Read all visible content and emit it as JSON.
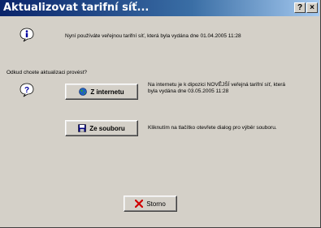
{
  "window": {
    "title": "Aktualizovat tarifní síť...",
    "help_button": "?",
    "close_button": "×"
  },
  "info": {
    "text": "Nyní používáte veřejnou tarifní síť, která byla vydána dne 01.04.2005 11:28"
  },
  "question": {
    "prompt": "Odkud chcete aktualizaci provést?"
  },
  "internet": {
    "button_label": "Z internetu",
    "desc_line1": "Na internetu je k dipozici NOVĚJŠÍ veřejná tarifní síť, která",
    "desc_line2": "byla vydána dne 03.05.2005 11:28"
  },
  "file": {
    "button_label": "Ze souboru",
    "desc": "Kliknutím na tlačítko otevřete dialog pro výběr souboru."
  },
  "cancel": {
    "button_label": "Storno"
  }
}
